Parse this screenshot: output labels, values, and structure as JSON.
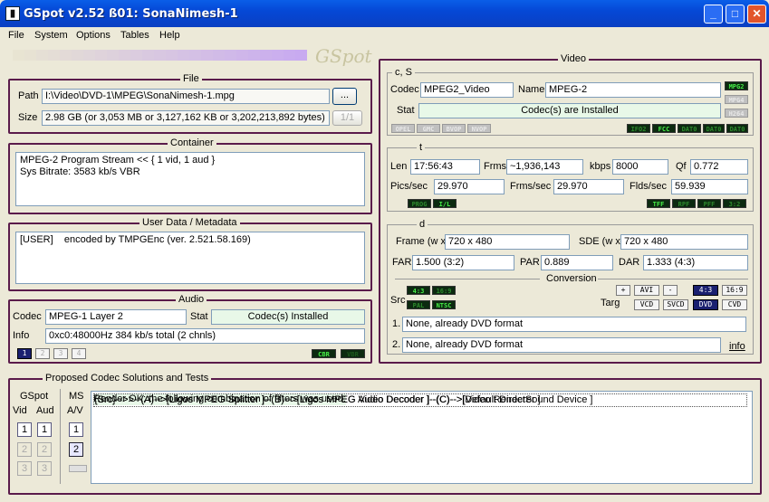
{
  "title": "GSpot v2.52 ß01: SonaNimesh-1",
  "window_buttons": {
    "minimize": "_",
    "maximize": "□",
    "close": "✕"
  },
  "menu": [
    "File",
    "System",
    "Options",
    "Tables",
    "Help"
  ],
  "logo": "GSpot",
  "file": {
    "label": "File",
    "path_label": "Path",
    "path": "I:\\Video\\DVD-1\\MPEG\\SonaNimesh-1.mpg",
    "browse": "...",
    "size_label": "Size",
    "size": "2.98 GB (or 3,053 MB or 3,127,162 KB or 3,202,213,892 bytes)",
    "page": "1/1"
  },
  "container": {
    "label": "Container",
    "line1": "MPEG-2 Program Stream << { 1 vid, 1 aud }",
    "line2": "Sys Bitrate: 3583 kb/s VBR"
  },
  "userdata": {
    "label": "User Data / Metadata",
    "text": "[USER]    encoded by TMPGEnc (ver. 2.521.58.169)"
  },
  "audio": {
    "label": "Audio",
    "codec_label": "Codec",
    "codec": "MPEG-1 Layer 2",
    "stat_label": "Stat",
    "stat": "Codec(s) Installed",
    "info_label": "Info",
    "info": "0xc0:48000Hz  384 kb/s total (2 chnls)",
    "streams": [
      "1",
      "2",
      "3",
      "4"
    ],
    "cbr": "CBR",
    "vbr": "VBR"
  },
  "video": {
    "label": "Video",
    "cs": {
      "label": "c, S",
      "codec_label": "Codec",
      "codec": "MPEG2_Video",
      "name_label": "Name",
      "name": "MPEG-2",
      "stat_label": "Stat",
      "stat": "Codec(s) are Installed",
      "leds_left": [
        "OPEL",
        "GMC",
        "BVOP",
        "NVOP"
      ],
      "leds_right": [
        "MPG2",
        "MPG4",
        "H264"
      ],
      "leds_bottom": [
        "IFO2",
        "FCC",
        "DAT0",
        "DAT0",
        "DAT0"
      ]
    },
    "t": {
      "label": "t",
      "len_label": "Len",
      "len": "17:56:43",
      "frms_label": "Frms",
      "frms": "~1,936,143",
      "kbps_label": "kbps",
      "kbps": "8000",
      "qf_label": "Qf",
      "qf": "0.772",
      "pics_label": "Pics/sec",
      "pics": "29.970",
      "frms_sec_label": "Frms/sec",
      "frms_sec": "29.970",
      "flds_label": "Flds/sec",
      "flds": "59.939",
      "leds_left": [
        "PROG",
        "I/L"
      ],
      "leds_right": [
        "TFF",
        "RPF",
        "PFF",
        "3:2"
      ]
    },
    "d": {
      "label": "d",
      "frame_label": "Frame (w x",
      "frame": "720 x 480",
      "sde_label": "SDE (w x",
      "sde": "720 x 480",
      "far_label": "FAR",
      "far": "1.500 (3:2)",
      "par_label": "PAR",
      "par": "0.889",
      "dar_label": "DAR",
      "dar": "1.333 (4:3)",
      "conversion_label": "Conversion",
      "src_label": "Src",
      "src_leds": [
        "4:3",
        "16:9",
        "PAL",
        "NTSC"
      ],
      "targ_label": "Targ",
      "targ_top": [
        "+",
        "AVI",
        "-",
        "4:3",
        "16:9"
      ],
      "targ_bottom": [
        "VCD",
        "SVCD",
        "DVD",
        "CVD"
      ],
      "conv1_num": "1.",
      "conv1": "None, already DVD format",
      "conv2_num": "2.",
      "conv2": "None, already DVD format",
      "info_link": "info"
    }
  },
  "proposed": {
    "label": "Proposed Codec Solutions and Tests",
    "gspot_label": "GSpot",
    "ms_label": "MS",
    "vid_label": "Vid",
    "aud_label": "Aud",
    "av_label": "A/V",
    "lines": [
      "Render OK; the following combination of filters was used:",
      "{Src}-->>--(A)-->[Ligos MPEG Splitter ]--(B)-->[Ligos MPEG Video Decoder ]--(C)-->[Video Renderer ]",
      "{Src}-->>--(A)-->[Ligos MPEG Splitter ]--(B)-->[Ligos MPEG Audio Decoder ]--(C)-->[Default DirectSound Device ]"
    ],
    "nums": [
      "1",
      "2",
      "3"
    ]
  }
}
